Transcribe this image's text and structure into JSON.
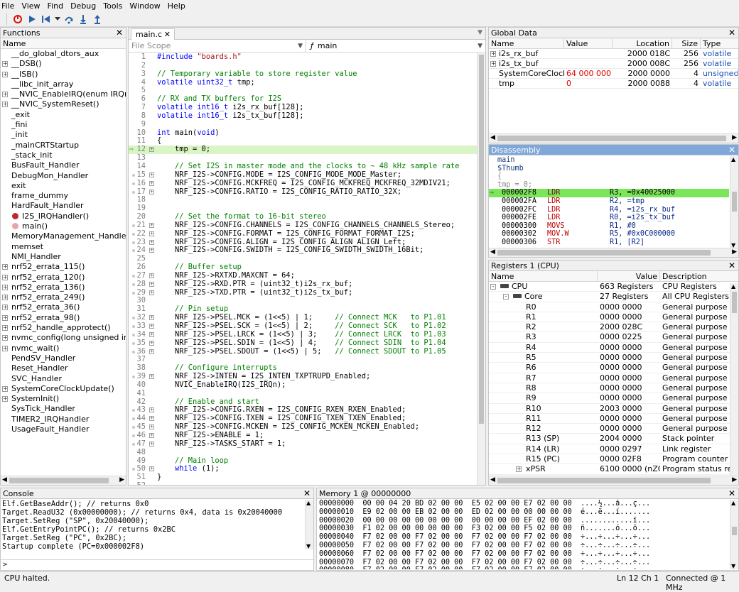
{
  "menu": [
    "File",
    "View",
    "Find",
    "Debug",
    "Tools",
    "Window",
    "Help"
  ],
  "functions": {
    "title": "Functions",
    "header": "Name",
    "items": [
      {
        "label": "__do_global_dtors_aux",
        "exp": false,
        "dot": ""
      },
      {
        "label": "__DSB()",
        "exp": true,
        "dot": ""
      },
      {
        "label": "__ISB()",
        "exp": true,
        "dot": ""
      },
      {
        "label": "__libc_init_array",
        "exp": false,
        "dot": ""
      },
      {
        "label": "__NVIC_EnableIRQ(enum IRQn_Ty",
        "exp": true,
        "dot": ""
      },
      {
        "label": "__NVIC_SystemReset()",
        "exp": true,
        "dot": ""
      },
      {
        "label": "_exit",
        "exp": false,
        "dot": ""
      },
      {
        "label": "_fini",
        "exp": false,
        "dot": ""
      },
      {
        "label": "_init",
        "exp": false,
        "dot": ""
      },
      {
        "label": "_mainCRTStartup",
        "exp": false,
        "dot": ""
      },
      {
        "label": "_stack_init",
        "exp": false,
        "dot": ""
      },
      {
        "label": "BusFault_Handler",
        "exp": false,
        "dot": ""
      },
      {
        "label": "DebugMon_Handler",
        "exp": false,
        "dot": ""
      },
      {
        "label": "exit",
        "exp": false,
        "dot": ""
      },
      {
        "label": "frame_dummy",
        "exp": false,
        "dot": ""
      },
      {
        "label": "HardFault_Handler",
        "exp": false,
        "dot": ""
      },
      {
        "label": "I2S_IRQHandler()",
        "exp": false,
        "dot": "#c0272d"
      },
      {
        "label": "main()",
        "exp": false,
        "dot": "#e8a4a8"
      },
      {
        "label": "MemoryManagement_Handler",
        "exp": false,
        "dot": ""
      },
      {
        "label": "memset",
        "exp": false,
        "dot": ""
      },
      {
        "label": "NMI_Handler",
        "exp": false,
        "dot": ""
      },
      {
        "label": "nrf52_errata_115()",
        "exp": true,
        "dot": ""
      },
      {
        "label": "nrf52_errata_120()",
        "exp": true,
        "dot": ""
      },
      {
        "label": "nrf52_errata_136()",
        "exp": true,
        "dot": ""
      },
      {
        "label": "nrf52_errata_249()",
        "exp": true,
        "dot": ""
      },
      {
        "label": "nrf52_errata_36()",
        "exp": true,
        "dot": ""
      },
      {
        "label": "nrf52_errata_98()",
        "exp": true,
        "dot": ""
      },
      {
        "label": "nrf52_handle_approtect()",
        "exp": true,
        "dot": ""
      },
      {
        "label": "nvmc_config(long unsigned int)",
        "exp": true,
        "dot": ""
      },
      {
        "label": "nvmc_wait()",
        "exp": true,
        "dot": ""
      },
      {
        "label": "PendSV_Handler",
        "exp": false,
        "dot": ""
      },
      {
        "label": "Reset_Handler",
        "exp": false,
        "dot": ""
      },
      {
        "label": "SVC_Handler",
        "exp": false,
        "dot": ""
      },
      {
        "label": "SystemCoreClockUpdate()",
        "exp": true,
        "dot": ""
      },
      {
        "label": "SystemInit()",
        "exp": true,
        "dot": ""
      },
      {
        "label": "SysTick_Handler",
        "exp": false,
        "dot": ""
      },
      {
        "label": "TIMER2_IRQHandler",
        "exp": false,
        "dot": ""
      },
      {
        "label": "UsageFault_Handler",
        "exp": false,
        "dot": ""
      }
    ]
  },
  "editor": {
    "tab": "main.c",
    "scope": "File Scope",
    "func_icon": "ƒ",
    "func": "main",
    "lines": [
      {
        "n": "1",
        "t": "#include \"boards.h\"",
        "c": "pp",
        "m": false,
        "e": false
      },
      {
        "n": "2",
        "t": "",
        "c": "",
        "m": false,
        "e": false
      },
      {
        "n": "3",
        "t": "// Temporary variable to store register value",
        "c": "cm",
        "m": false,
        "e": false
      },
      {
        "n": "4",
        "t": "volatile uint32_t tmp;",
        "c": "decl",
        "m": false,
        "e": false
      },
      {
        "n": "5",
        "t": "",
        "c": "",
        "m": false,
        "e": false
      },
      {
        "n": "6",
        "t": "// RX and TX buffers for I2S",
        "c": "cm",
        "m": false,
        "e": false
      },
      {
        "n": "7",
        "t": "volatile int16_t i2s_rx_buf[128];",
        "c": "decl",
        "m": false,
        "e": false
      },
      {
        "n": "8",
        "t": "volatile int16_t i2s_tx_buf[128];",
        "c": "decl",
        "m": false,
        "e": false
      },
      {
        "n": "9",
        "t": "",
        "c": "",
        "m": false,
        "e": false
      },
      {
        "n": "10",
        "t": "int main(void)",
        "c": "decl",
        "m": false,
        "e": false
      },
      {
        "n": "11",
        "t": "{",
        "c": "",
        "m": false,
        "e": false
      },
      {
        "n": "12",
        "t": "    tmp = 0;",
        "c": "",
        "m": false,
        "e": true
      },
      {
        "n": "13",
        "t": "",
        "c": "",
        "m": false,
        "e": false
      },
      {
        "n": "14",
        "t": "    // Set I2S in master mode and the clocks to ~ 48 kHz sample rate",
        "c": "cm",
        "m": false,
        "e": false
      },
      {
        "n": "15",
        "t": "    NRF_I2S->CONFIG.MODE = I2S_CONFIG_MODE_MODE_Master;",
        "c": "",
        "m": true,
        "e": true
      },
      {
        "n": "16",
        "t": "    NRF_I2S->CONFIG.MCKFREQ = I2S_CONFIG_MCKFREQ_MCKFREQ_32MDIV21;",
        "c": "",
        "m": true,
        "e": true
      },
      {
        "n": "17",
        "t": "    NRF_I2S->CONFIG.RATIO = I2S_CONFIG_RATIO_RATIO_32X;",
        "c": "",
        "m": true,
        "e": true
      },
      {
        "n": "18",
        "t": "",
        "c": "",
        "m": false,
        "e": false
      },
      {
        "n": "19",
        "t": "",
        "c": "",
        "m": false,
        "e": false
      },
      {
        "n": "20",
        "t": "    // Set the format to 16-bit stereo",
        "c": "cm",
        "m": false,
        "e": false
      },
      {
        "n": "21",
        "t": "    NRF_I2S->CONFIG.CHANNELS = I2S_CONFIG_CHANNELS_CHANNELS_Stereo;",
        "c": "",
        "m": true,
        "e": true
      },
      {
        "n": "22",
        "t": "    NRF_I2S->CONFIG.FORMAT = I2S_CONFIG_FORMAT_FORMAT_I2S;",
        "c": "",
        "m": true,
        "e": true
      },
      {
        "n": "23",
        "t": "    NRF_I2S->CONFIG.ALIGN = I2S_CONFIG_ALIGN_ALIGN_Left;",
        "c": "",
        "m": true,
        "e": true
      },
      {
        "n": "24",
        "t": "    NRF_I2S->CONFIG.SWIDTH = I2S_CONFIG_SWIDTH_SWIDTH_16Bit;",
        "c": "",
        "m": true,
        "e": true
      },
      {
        "n": "25",
        "t": "",
        "c": "",
        "m": false,
        "e": false
      },
      {
        "n": "26",
        "t": "    // Buffer setup",
        "c": "cm",
        "m": false,
        "e": false
      },
      {
        "n": "27",
        "t": "    NRF_I2S->RXTXD.MAXCNT = 64;",
        "c": "",
        "m": true,
        "e": true
      },
      {
        "n": "28",
        "t": "    NRF_I2S->RXD.PTR = (uint32_t)i2s_rx_buf;",
        "c": "",
        "m": true,
        "e": true
      },
      {
        "n": "29",
        "t": "    NRF_I2S->TXD.PTR = (uint32_t)i2s_tx_buf;",
        "c": "",
        "m": true,
        "e": true
      },
      {
        "n": "30",
        "t": "",
        "c": "",
        "m": false,
        "e": false
      },
      {
        "n": "31",
        "t": "    // Pin setup",
        "c": "cm",
        "m": false,
        "e": false
      },
      {
        "n": "32",
        "t": "    NRF_I2S->PSEL.MCK = (1<<5) | 1;     ",
        "tc": "// Connect MCK   to P1.01",
        "c": "",
        "m": true,
        "e": true
      },
      {
        "n": "33",
        "t": "    NRF_I2S->PSEL.SCK = (1<<5) | 2;     ",
        "tc": "// Connect SCK   to P1.02",
        "c": "",
        "m": true,
        "e": true
      },
      {
        "n": "34",
        "t": "    NRF_I2S->PSEL.LRCK = (1<<5) | 3;    ",
        "tc": "// Connect LRCK  to P1.03",
        "c": "",
        "m": true,
        "e": true
      },
      {
        "n": "35",
        "t": "    NRF_I2S->PSEL.SDIN = (1<<5) | 4;    ",
        "tc": "// Connect SDIN  to P1.04",
        "c": "",
        "m": true,
        "e": true
      },
      {
        "n": "36",
        "t": "    NRF_I2S->PSEL.SDOUT = (1<<5) | 5;   ",
        "tc": "// Connect SDOUT to P1.05",
        "c": "",
        "m": true,
        "e": true
      },
      {
        "n": "37",
        "t": "",
        "c": "",
        "m": false,
        "e": false
      },
      {
        "n": "38",
        "t": "    // Configure interrupts",
        "c": "cm",
        "m": false,
        "e": false
      },
      {
        "n": "39",
        "t": "    NRF_I2S->INTEN = I2S_INTEN_TXPTRUPD_Enabled;",
        "c": "",
        "m": true,
        "e": true
      },
      {
        "n": "40",
        "t": "    NVIC_EnableIRQ(I2S_IRQn);",
        "c": "",
        "m": false,
        "e": false
      },
      {
        "n": "41",
        "t": "",
        "c": "",
        "m": false,
        "e": false
      },
      {
        "n": "42",
        "t": "    // Enable and start",
        "c": "cm",
        "m": false,
        "e": false
      },
      {
        "n": "43",
        "t": "    NRF_I2S->CONFIG.RXEN = I2S_CONFIG_RXEN_RXEN_Enabled;",
        "c": "",
        "m": true,
        "e": true
      },
      {
        "n": "44",
        "t": "    NRF_I2S->CONFIG.TXEN = I2S_CONFIG_TXEN_TXEN_Enabled;",
        "c": "",
        "m": true,
        "e": true
      },
      {
        "n": "45",
        "t": "    NRF_I2S->CONFIG.MCKEN = I2S_CONFIG_MCKEN_MCKEN_Enabled;",
        "c": "",
        "m": true,
        "e": true
      },
      {
        "n": "46",
        "t": "    NRF_I2S->ENABLE = 1;",
        "c": "",
        "m": true,
        "e": true
      },
      {
        "n": "47",
        "t": "    NRF_I2S->TASKS_START = 1;",
        "c": "",
        "m": true,
        "e": true
      },
      {
        "n": "48",
        "t": "",
        "c": "",
        "m": false,
        "e": false
      },
      {
        "n": "49",
        "t": "    // Main loop",
        "c": "cm",
        "m": false,
        "e": false
      },
      {
        "n": "50",
        "t": "    while (1);",
        "c": "while",
        "m": true,
        "e": true
      },
      {
        "n": "51",
        "t": "}",
        "c": "",
        "m": false,
        "e": false
      },
      {
        "n": "52",
        "t": "",
        "c": "",
        "m": false,
        "e": false
      }
    ],
    "current_line": "12"
  },
  "globals": {
    "title": "Global Data",
    "headers": [
      "Name",
      "Value",
      "Location",
      "Size",
      "Type"
    ],
    "rows": [
      {
        "name": "i2s_rx_buf",
        "value": "",
        "location": "2000 018C",
        "size": "256",
        "type": "volatile",
        "exp": true,
        "vcolor": ""
      },
      {
        "name": "i2s_tx_buf",
        "value": "",
        "location": "2000 008C",
        "size": "256",
        "type": "volatile",
        "exp": true,
        "vcolor": ""
      },
      {
        "name": "SystemCoreClock",
        "value": "64 000 000",
        "location": "2000 0000",
        "size": "4",
        "type": "unsigned",
        "exp": false,
        "vcolor": "#e00000"
      },
      {
        "name": "tmp",
        "value": "0",
        "location": "2000 0088",
        "size": "4",
        "type": "volatile",
        "exp": false,
        "vcolor": "#e00000"
      }
    ]
  },
  "disasm": {
    "title": "Disassembly",
    "source": [
      "main",
      "$Thumb",
      "{",
      "tmp = 0;"
    ],
    "rows": [
      {
        "addr": "000002F8",
        "mn": "LDR",
        "ops": "R3, =0x40025000",
        "cur": true
      },
      {
        "addr": "000002FA",
        "mn": "LDR",
        "ops": "R2, =tmp",
        "cur": false
      },
      {
        "addr": "000002FC",
        "mn": "LDR",
        "ops": "R4, =i2s_rx_buf",
        "cur": false
      },
      {
        "addr": "000002FE",
        "mn": "LDR",
        "ops": "R0, =i2s_tx_buf",
        "cur": false
      },
      {
        "addr": "00000300",
        "mn": "MOVS",
        "ops": "R1, #0",
        "cur": false
      },
      {
        "addr": "00000302",
        "mn": "MOV.W",
        "ops": "R5, #0x0C000000",
        "cur": false
      },
      {
        "addr": "00000306",
        "mn": "STR",
        "ops": "R1, [R2]",
        "cur": false
      }
    ]
  },
  "registers": {
    "title": "Registers 1 (CPU)",
    "headers": [
      "Name",
      "Value",
      "Description"
    ],
    "rows": [
      {
        "name": "CPU",
        "value": "663 Registers",
        "desc": "CPU Registers",
        "indent": 0,
        "exp": "-",
        "chip": true
      },
      {
        "name": "Core",
        "value": "27 Registers",
        "desc": "All CPU Registers",
        "indent": 1,
        "exp": "-",
        "chip": true
      },
      {
        "name": "R0",
        "value": "0000 0000",
        "desc": "General purpose regi",
        "indent": 2,
        "exp": "",
        "chip": false
      },
      {
        "name": "R1",
        "value": "0000 0000",
        "desc": "General purpose regi",
        "indent": 2,
        "exp": "",
        "chip": false
      },
      {
        "name": "R2",
        "value": "2000 028C",
        "desc": "General purpose regi",
        "indent": 2,
        "exp": "",
        "chip": false
      },
      {
        "name": "R3",
        "value": "0000 0225",
        "desc": "General purpose regi",
        "indent": 2,
        "exp": "",
        "chip": false
      },
      {
        "name": "R4",
        "value": "0000 0000",
        "desc": "General purpose regi",
        "indent": 2,
        "exp": "",
        "chip": false
      },
      {
        "name": "R5",
        "value": "0000 0000",
        "desc": "General purpose regi",
        "indent": 2,
        "exp": "",
        "chip": false
      },
      {
        "name": "R6",
        "value": "0000 0000",
        "desc": "General purpose regi",
        "indent": 2,
        "exp": "",
        "chip": false
      },
      {
        "name": "R7",
        "value": "0000 0000",
        "desc": "General purpose regi",
        "indent": 2,
        "exp": "",
        "chip": false
      },
      {
        "name": "R8",
        "value": "0000 0000",
        "desc": "General purpose regi",
        "indent": 2,
        "exp": "",
        "chip": false
      },
      {
        "name": "R9",
        "value": "0000 0000",
        "desc": "General purpose regi",
        "indent": 2,
        "exp": "",
        "chip": false
      },
      {
        "name": "R10",
        "value": "2003 0000",
        "desc": "General purpose regi",
        "indent": 2,
        "exp": "",
        "chip": false
      },
      {
        "name": "R11",
        "value": "0000 0000",
        "desc": "General purpose regi",
        "indent": 2,
        "exp": "",
        "chip": false
      },
      {
        "name": "R12",
        "value": "0000 0000",
        "desc": "General purpose regi",
        "indent": 2,
        "exp": "",
        "chip": false
      },
      {
        "name": "R13 (SP)",
        "value": "2004 0000",
        "desc": "Stack pointer",
        "indent": 2,
        "exp": "",
        "chip": false
      },
      {
        "name": "R14 (LR)",
        "value": "0000 0297",
        "desc": "Link register",
        "indent": 2,
        "exp": "",
        "chip": false
      },
      {
        "name": "R15 (PC)",
        "value": "0000 02F8",
        "desc": "Program counter",
        "indent": 2,
        "exp": "",
        "chip": false
      },
      {
        "name": "xPSR",
        "value": "6100 0000 (nZC",
        "desc": "Program status regi",
        "indent": 2,
        "exp": "+",
        "chip": false
      }
    ]
  },
  "console": {
    "title": "Console",
    "lines": [
      "Elf.GetBaseAddr(); // returns 0x0",
      "Target.ReadU32 (0x00000000); // returns 0x4, data is 0x20040000",
      "Target.SetReg (\"SP\", 0x20040000);",
      "Elf.GetEntryPointPC(); // returns 0x2BC",
      "Target.SetReg (\"PC\", 0x2BC);",
      "Startup complete (PC=0x000002F8)"
    ],
    "prompt": ">"
  },
  "memory": {
    "title": "Memory 1 @ 00000000",
    "lines": [
      {
        "addr": "00000000",
        "hex": "00 00 04 20 BD 02 00 00  E5 02 00 00 E7 02 00 00",
        "ascii": "....½...å...ç..."
      },
      {
        "addr": "00000010",
        "hex": "E9 02 00 00 EB 02 00 00  ED 02 00 00 00 00 00 00",
        "ascii": "é...ë...í......."
      },
      {
        "addr": "00000020",
        "hex": "00 00 00 00 00 00 00 00  00 00 00 00 EF 02 00 00",
        "ascii": "............ï..."
      },
      {
        "addr": "00000030",
        "hex": "F1 02 00 00 00 00 00 00  F3 02 00 00 F5 02 00 00",
        "ascii": "ñ.......ó...õ..."
      },
      {
        "addr": "00000040",
        "hex": "F7 02 00 00 F7 02 00 00  F7 02 00 00 F7 02 00 00",
        "ascii": "÷...÷...÷...÷..."
      },
      {
        "addr": "00000050",
        "hex": "F7 02 00 00 F7 02 00 00  F7 02 00 00 F7 02 00 00",
        "ascii": "÷...÷...÷...÷..."
      },
      {
        "addr": "00000060",
        "hex": "F7 02 00 00 F7 02 00 00  F7 02 00 00 F7 02 00 00",
        "ascii": "÷...÷...÷...÷..."
      },
      {
        "addr": "00000070",
        "hex": "F7 02 00 00 F7 02 00 00  F7 02 00 00 F7 02 00 00",
        "ascii": "÷...÷...÷...÷..."
      },
      {
        "addr": "00000080",
        "hex": "F7 02 00 00 F7 02 00 00  F7 02 00 00 F7 02 00 00",
        "ascii": "÷...÷...÷...÷..."
      }
    ]
  },
  "status": {
    "left": "CPU halted.",
    "position": "Ln 12  Ch 1",
    "connection": "Connected @ 1 MHz"
  },
  "colors": {
    "current_line_bg": "#d9f5c5",
    "disasm_current_bg": "#7ce65b",
    "keyword": "#0000ff",
    "comment": "#008000",
    "string": "#a31515",
    "disasm_mnemonic": "#c00000",
    "active_title": "#7fa7d9"
  }
}
